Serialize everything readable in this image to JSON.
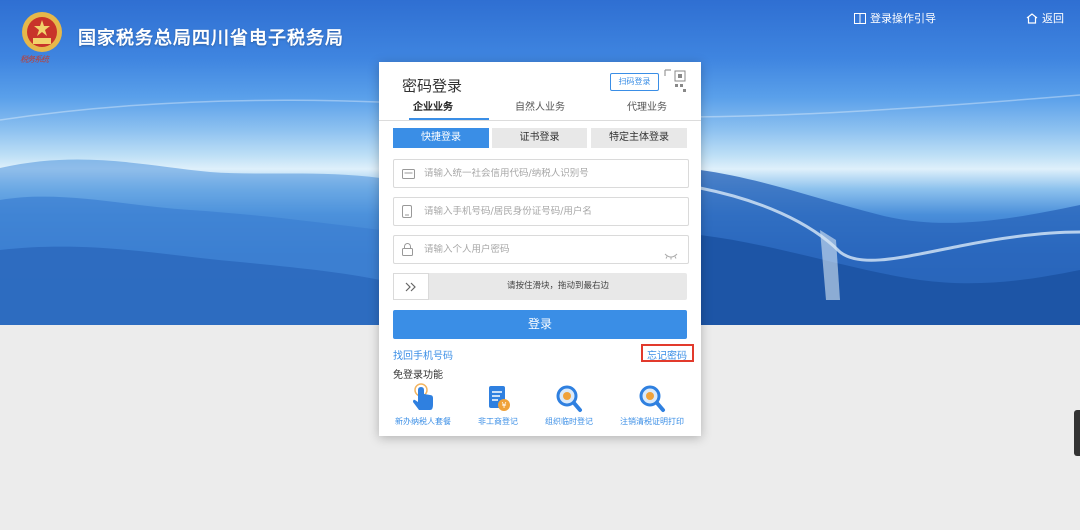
{
  "header": {
    "title": "国家税务总局四川省电子税务局",
    "logo_script": "税务系统",
    "guide_link": "登录操作引导",
    "back_link": "返回"
  },
  "login_card": {
    "title": "密码登录",
    "qr_login": "扫码登录",
    "business_tabs": [
      "企业业务",
      "自然人业务",
      "代理业务"
    ],
    "mode_tabs": [
      "快捷登录",
      "证书登录",
      "特定主体登录"
    ],
    "fields": {
      "taxpayer_id_placeholder": "请输入统一社会信用代码/纳税人识别号",
      "account_placeholder": "请输入手机号码/居民身份证号码/用户名",
      "password_placeholder": "请输入个人用户密码"
    },
    "slider_text": "请按住滑块，拖动到最右边",
    "login_button": "登录",
    "recover_phone": "找回手机号码",
    "forgot_password": "忘记密码",
    "no_login_label": "免登录功能",
    "shortcuts": [
      "新办纳税人套餐",
      "非工商登记",
      "组织临时登记",
      "注销清税证明打印"
    ]
  },
  "colors": {
    "accent": "#3a8ee6",
    "highlight_border": "#e23a2c"
  },
  "icons": [
    "emblem-icon",
    "book-icon",
    "home-icon",
    "id-card-icon",
    "phone-icon",
    "lock-icon",
    "eye-closed-icon",
    "double-chevron-icon",
    "qr-code-icon",
    "hand-pointer-icon",
    "document-yuan-icon",
    "search-magnifier-icon"
  ]
}
